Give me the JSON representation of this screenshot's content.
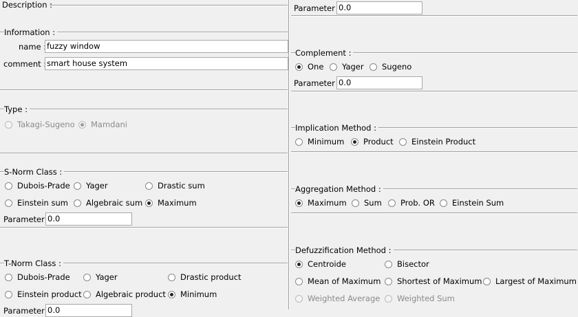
{
  "description": {
    "label": "Description :"
  },
  "information": {
    "legend": "Information :",
    "name_label": "name :",
    "name_value": "fuzzy window",
    "comment_label": "comment :",
    "comment_value": "smart house system"
  },
  "type": {
    "legend": "Type :",
    "options": [
      "Takagi-Sugeno",
      "Mamdani"
    ],
    "selected": "Mamdani",
    "disabled": true
  },
  "snorm": {
    "legend": "S-Norm Class :",
    "options": [
      "Dubois-Prade",
      "Yager",
      "Drastic sum",
      "Einstein sum",
      "Algebraic sum",
      "Maximum"
    ],
    "selected": "Maximum",
    "parameter_label": "Parameter :",
    "parameter_value": "0.0"
  },
  "tnorm": {
    "legend": "T-Norm Class :",
    "options": [
      "Dubois-Prade",
      "Yager",
      "Drastic product",
      "Einstein product",
      "Algebraic product",
      "Minimum"
    ],
    "selected": "Minimum",
    "parameter_label": "Parameter :",
    "parameter_value": "0.0"
  },
  "top_parameter": {
    "label": "Parameter :",
    "value": "0.0"
  },
  "complement": {
    "legend": "Complement :",
    "options": [
      "One",
      "Yager",
      "Sugeno"
    ],
    "selected": "One",
    "parameter_label": "Parameter :",
    "parameter_value": "0.0"
  },
  "implication": {
    "legend": "Implication Method :",
    "options": [
      "Minimum",
      "Product",
      "Einstein Product"
    ],
    "selected": "Product"
  },
  "aggregation": {
    "legend": "Aggregation Method :",
    "options": [
      "Maximum",
      "Sum",
      "Prob. OR",
      "Einstein Sum"
    ],
    "selected": "Maximum"
  },
  "defuzzification": {
    "legend": "Defuzzification Method :",
    "options": [
      "Centroide",
      "Bisector",
      "Mean of Maximum",
      "Shortest of Maximum",
      "Largest of Maximum",
      "Weighted Average",
      "Weighted Sum"
    ],
    "selected": "Centroide",
    "disabled_options": [
      "Weighted Average",
      "Weighted Sum"
    ]
  }
}
